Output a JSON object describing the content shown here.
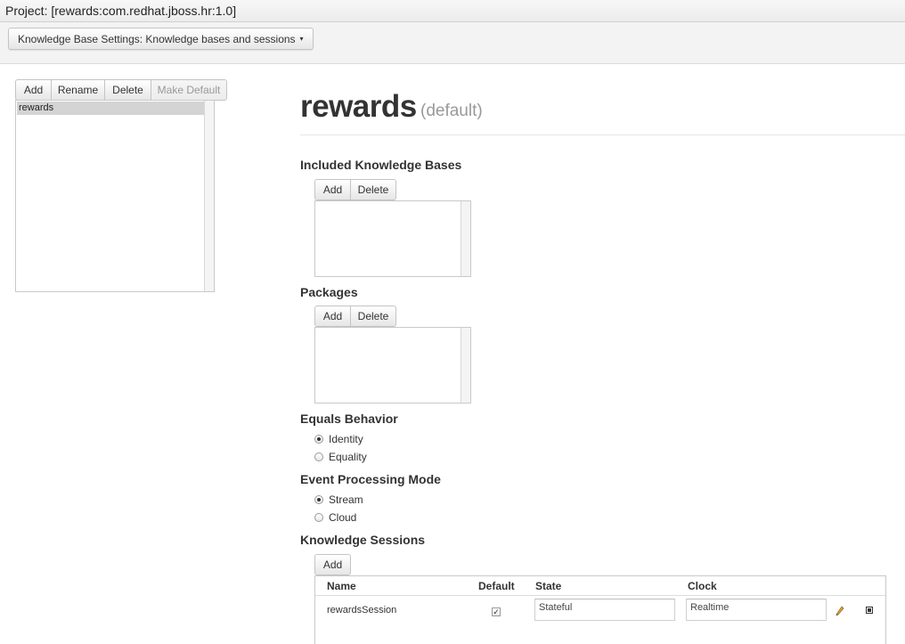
{
  "window": {
    "title": "Project: [rewards:com.redhat.jboss.hr:1.0]"
  },
  "toolbar": {
    "settings_dropdown": "Knowledge Base Settings: Knowledge bases and sessions",
    "caret": "▾"
  },
  "kb_list": {
    "buttons": {
      "add": "Add",
      "rename": "Rename",
      "delete": "Delete",
      "make_default": "Make Default"
    },
    "items": [
      "rewards"
    ]
  },
  "kb_detail": {
    "name": "rewards",
    "default_badge": "(default)",
    "included_kbs": {
      "heading": "Included Knowledge Bases",
      "add": "Add",
      "delete": "Delete"
    },
    "packages": {
      "heading": "Packages",
      "add": "Add",
      "delete": "Delete"
    },
    "equals_behavior": {
      "heading": "Equals Behavior",
      "options": [
        "Identity",
        "Equality"
      ],
      "selected": "Identity"
    },
    "event_processing": {
      "heading": "Event Processing Mode",
      "options": [
        "Stream",
        "Cloud"
      ],
      "selected": "Stream"
    },
    "sessions": {
      "heading": "Knowledge Sessions",
      "add": "Add",
      "columns": [
        "Name",
        "Default",
        "State",
        "Clock"
      ],
      "rows": [
        {
          "name": "rewardsSession",
          "default": true,
          "default_mark": "✓",
          "state": "Stateful",
          "clock": "Realtime"
        }
      ]
    }
  }
}
